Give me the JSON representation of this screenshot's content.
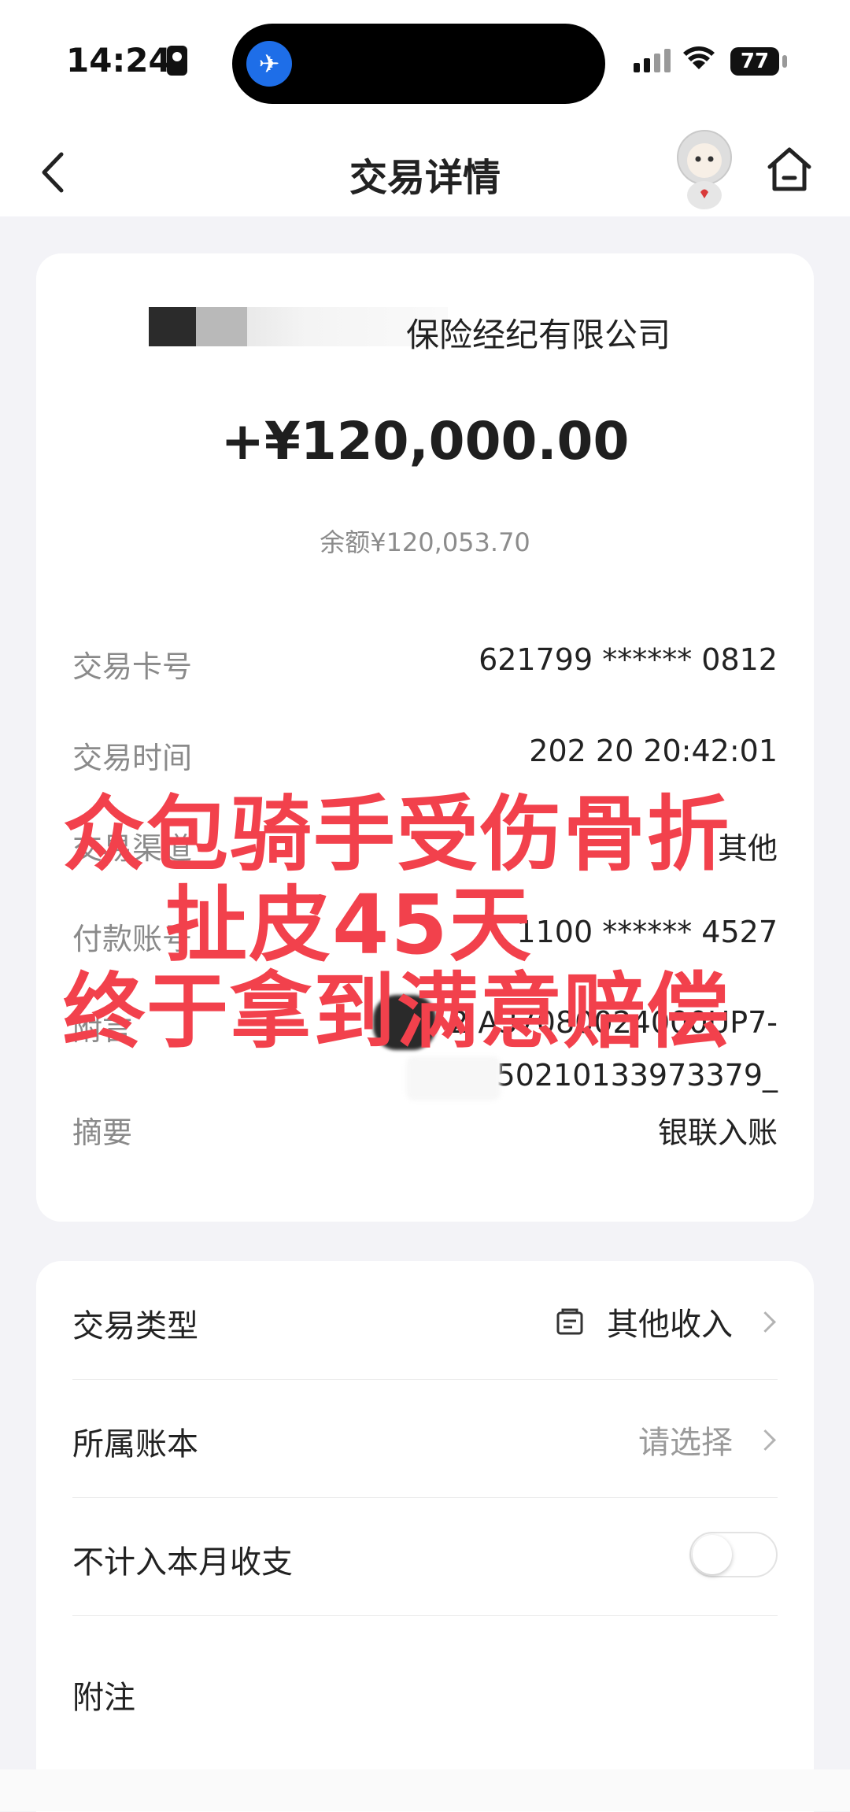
{
  "status_bar": {
    "time": "14:24",
    "battery": "77",
    "island_app_glyph": "✈"
  },
  "nav": {
    "title": "交易详情"
  },
  "transaction": {
    "payer": "保险经纪有限公司",
    "amount": "+¥120,000.00",
    "balance": "余额¥120,053.70"
  },
  "details": [
    {
      "label": "交易卡号",
      "value": "621799 ****** 0812"
    },
    {
      "label": "交易时间",
      "value": "202      20 20:42:01"
    },
    {
      "label": "交易渠道",
      "value": "其他"
    },
    {
      "label": "付款账号",
      "value": "1100 ****** 4527"
    },
    {
      "label": "附言",
      "value": "2    A37080024000UP7-",
      "value2": "850210133973379_"
    },
    {
      "label": "摘要",
      "value": "银联入账"
    }
  ],
  "settings": {
    "type_label": "交易类型",
    "type_value": "其他收入",
    "book_label": "所属账本",
    "book_value": "请选择",
    "exclude_label": "不计入本月收支",
    "exclude_on": false,
    "note_label": "附注"
  },
  "overlay": {
    "line1": "众包骑手受伤骨折",
    "line2": "扯皮45天",
    "line3": "终于拿到满意赔偿"
  },
  "colors": {
    "overlay_red": "#f2414c",
    "island_blue": "#1e6ee8"
  }
}
